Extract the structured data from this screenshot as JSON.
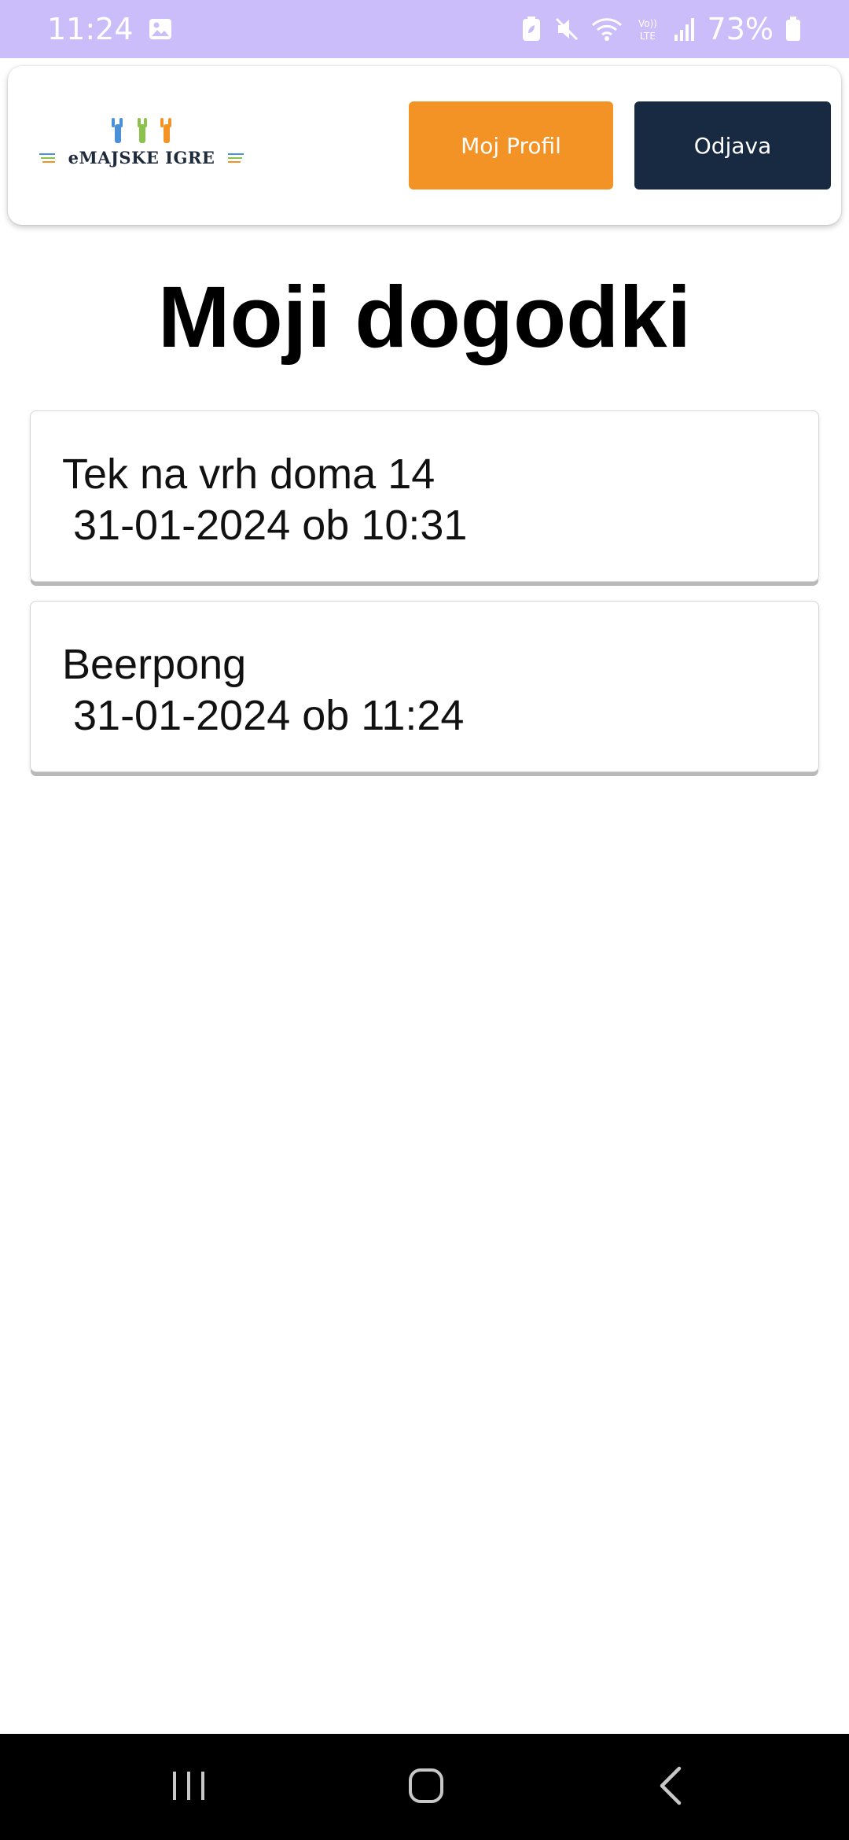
{
  "status_bar": {
    "time": "11:24",
    "battery": "73%",
    "background": "#cbbdf9"
  },
  "header": {
    "logo_text": "eMAJSKE IGRE",
    "profile_button": "Moj Profil",
    "logout_button": "Odjava",
    "profile_color": "#f39325",
    "logout_color": "#182a41"
  },
  "page": {
    "title": "Moji dogodki"
  },
  "events": [
    {
      "name": "Tek na vrh doma 14",
      "datetime": "31-01-2024 ob 10:31"
    },
    {
      "name": "Beerpong",
      "datetime": "31-01-2024 ob 11:24"
    }
  ],
  "icons": {
    "status_left": [
      "gallery-icon"
    ],
    "status_right": [
      "battery-saver-icon",
      "mute-icon",
      "wifi-icon",
      "volte-icon",
      "signal-icon",
      "battery-icon"
    ],
    "navigation": [
      "recent-apps-icon",
      "home-icon",
      "back-icon"
    ]
  }
}
